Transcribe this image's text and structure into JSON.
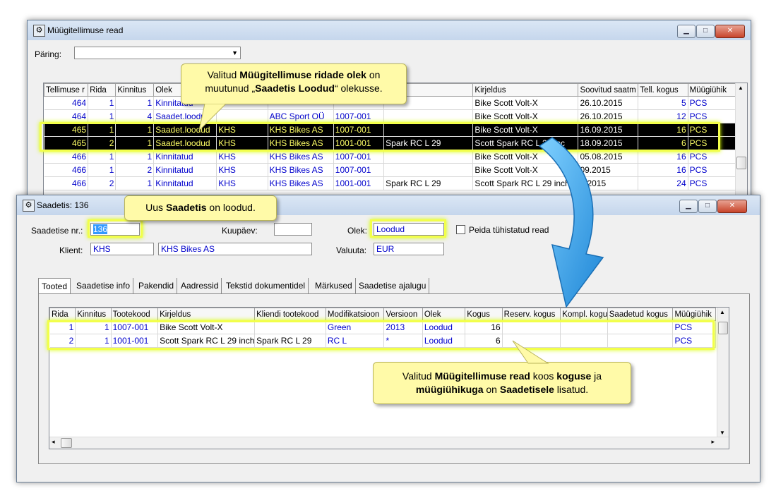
{
  "colors": {
    "highlight": "#f2ff4a",
    "callout_bg": "#fffaa8",
    "link_blue": "#0000cc",
    "selected_row": "#000000",
    "arrow": "#2a9ee8"
  },
  "order_window": {
    "title": "Müügitellimuse read",
    "query_label": "Päring:",
    "query_value": "",
    "columns": [
      "Tellimuse r",
      "Rida",
      "Kinnitus",
      "Olek",
      "",
      "",
      "tootekood",
      "Kirjeldus",
      "Soovitud saatm",
      "Tell. kogus",
      "Müügiühik"
    ],
    "rows": [
      {
        "order": "464",
        "row": "1",
        "conf": "1",
        "status": "Kinnitatud",
        "client": "",
        "client_name": "",
        "code": "",
        "mod": "",
        "desc": "Bike Scott Volt-X",
        "date": "26.10.2015",
        "qty": "5",
        "unit": "PCS"
      },
      {
        "order": "464",
        "row": "1",
        "conf": "4",
        "status": "Saadet.loodud",
        "client": "",
        "client_name": "ABC Sport OÜ",
        "code": "1007-001",
        "mod": "",
        "desc": "Bike Scott Volt-X",
        "date": "26.10.2015",
        "qty": "12",
        "unit": "PCS"
      },
      {
        "order": "465",
        "row": "1",
        "conf": "1",
        "status": "Saadet.loodud",
        "client": "KHS",
        "client_name": "KHS Bikes AS",
        "code": "1007-001",
        "mod": "",
        "desc": "Bike Scott Volt-X",
        "date": "16.09.2015",
        "qty": "16",
        "unit": "PCS"
      },
      {
        "order": "465",
        "row": "2",
        "conf": "1",
        "status": "Saadet.loodud",
        "client": "KHS",
        "client_name": "KHS Bikes AS",
        "code": "1001-001",
        "mod": "Spark RC L 29",
        "desc": "Scott Spark RC L 29 inc",
        "date": "18.09.2015",
        "qty": "6",
        "unit": "PCS"
      },
      {
        "order": "466",
        "row": "1",
        "conf": "1",
        "status": "Kinnitatud",
        "client": "KHS",
        "client_name": "KHS Bikes AS",
        "code": "1007-001",
        "mod": "",
        "desc": "Bike Scott Volt-X",
        "date": "05.08.2015",
        "qty": "16",
        "unit": "PCS"
      },
      {
        "order": "466",
        "row": "1",
        "conf": "2",
        "status": "Kinnitatud",
        "client": "KHS",
        "client_name": "KHS Bikes AS",
        "code": "1007-001",
        "mod": "",
        "desc": "Bike Scott Volt-X",
        "date": "09.2015",
        "qty": "16",
        "unit": "PCS"
      },
      {
        "order": "466",
        "row": "2",
        "conf": "1",
        "status": "Kinnitatud",
        "client": "KHS",
        "client_name": "KHS Bikes AS",
        "code": "1001-001",
        "mod": "Spark RC L 29",
        "desc": "Scott Spark RC L 29 inch",
        "date": "7.2015",
        "qty": "24",
        "unit": "PCS"
      }
    ]
  },
  "callout_top": {
    "line1_pre": "Valitud ",
    "line1_bold": "Müügitellimuse ridade olek",
    "line1_post": " on",
    "line2_pre": "muutunud „",
    "line2_bold": "Saadetis Loodud",
    "line2_post": "“ olekusse."
  },
  "callout_mid": {
    "pre": "Uus ",
    "bold": "Saadetis",
    "post": " on loodud."
  },
  "callout_bottom": {
    "l1a": "Valitud ",
    "l1b": "Müügitellimuse read",
    "l1c": " koos ",
    "l1d": "koguse",
    "l1e": " ja",
    "l2a": "müügiühikuga",
    "l2b": " on ",
    "l2c": "Saadetisele",
    "l2d": " lisatud."
  },
  "shipment_window": {
    "title": "Saadetis: 136",
    "shipment_nr_label": "Saadetise nr.:",
    "shipment_nr": "136",
    "date_label": "Kuupäev:",
    "date_value": "",
    "status_label": "Olek:",
    "status_value": "Loodud",
    "hide_label": "Peida tühistatud read",
    "client_label": "Klient:",
    "client_code": "KHS",
    "client_name": "KHS Bikes AS",
    "currency_label": "Valuuta:",
    "currency": "EUR",
    "tabs": [
      "Tooted",
      "Saadetise info",
      "Pakendid",
      "Aadressid",
      "Tekstid dokumentidel",
      "Märkused",
      "Saadetise ajalugu"
    ],
    "columns": [
      "Rida",
      "Kinnitus",
      "Tootekood",
      "Kirjeldus",
      "Kliendi tootekood",
      "Modifikatsioon",
      "Versioon",
      "Olek",
      "Kogus",
      "Reserv. kogus",
      "Kompl. kogu",
      "Saadetud kogus",
      "Müügiühik"
    ],
    "rows": [
      {
        "row": "1",
        "conf": "1",
        "code": "1007-001",
        "desc": "Bike Scott Volt-X",
        "client_code": "",
        "mod": "Green",
        "ver": "2013",
        "status": "Loodud",
        "qty": "16",
        "reserved": "",
        "kompl": "",
        "sent": "",
        "unit": "PCS"
      },
      {
        "row": "2",
        "conf": "1",
        "code": "1001-001",
        "desc": "Scott Spark RC L 29 inch",
        "client_code": "Spark RC L 29",
        "mod": "RC L",
        "ver": "*",
        "status": "Loodud",
        "qty": "6",
        "reserved": "",
        "kompl": "",
        "sent": "",
        "unit": "PCS"
      }
    ]
  },
  "window_buttons": {
    "minimize": "▁",
    "maximize": "□",
    "close": "✕"
  }
}
